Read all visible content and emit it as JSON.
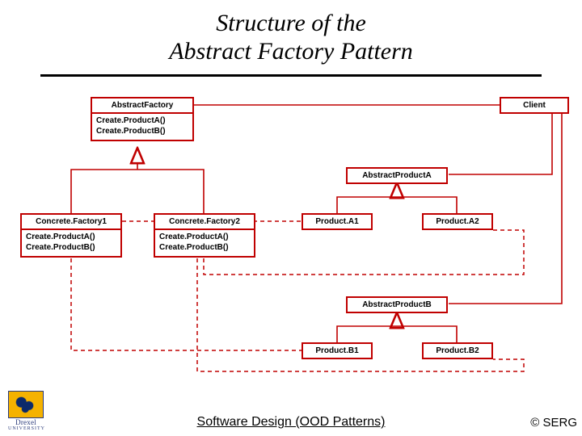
{
  "title_line1": "Structure of the",
  "title_line2": "Abstract Factory Pattern",
  "boxes": {
    "abstract_factory": {
      "name": "AbstractFactory",
      "ops": [
        "Create.ProductA()",
        "Create.ProductB()"
      ]
    },
    "client": {
      "name": "Client"
    },
    "abstract_product_a": {
      "name": "AbstractProductA"
    },
    "concrete_factory_1": {
      "name": "Concrete.Factory1",
      "ops": [
        "Create.ProductA()",
        "Create.ProductB()"
      ]
    },
    "concrete_factory_2": {
      "name": "Concrete.Factory2",
      "ops": [
        "Create.ProductA()",
        "Create.ProductB()"
      ]
    },
    "product_a1": {
      "name": "Product.A1"
    },
    "product_a2": {
      "name": "Product.A2"
    },
    "abstract_product_b": {
      "name": "AbstractProductB"
    },
    "product_b1": {
      "name": "Product.B1"
    },
    "product_b2": {
      "name": "Product.B2"
    }
  },
  "footer": {
    "course": "Software Design (OOD Patterns)",
    "copy": "© SERG"
  },
  "logo": {
    "university_line1": "Drexel",
    "university_line2": "UNIVERSITY"
  }
}
